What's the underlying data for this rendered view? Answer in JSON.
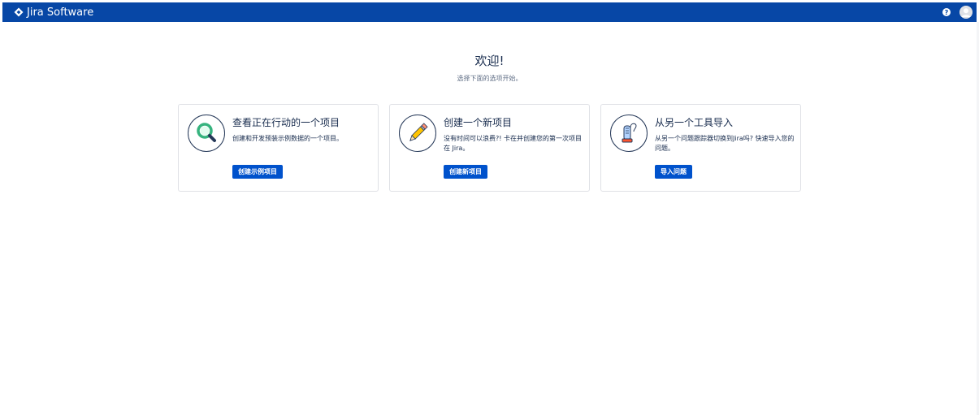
{
  "header": {
    "brand_label": "Jira Software",
    "help_icon_glyph": "?",
    "colors": {
      "bar": "#0747a6",
      "button": "#0052cc"
    }
  },
  "welcome": {
    "title": "欢迎!",
    "subtitle": "选择下面的选项开始。"
  },
  "cards": [
    {
      "icon": "magnifier-icon",
      "title": "查看正在行动的一个项目",
      "description": "创建和开发预装示例数据的一个项目。",
      "button_label": "创建示例项目"
    },
    {
      "icon": "pencil-icon",
      "title": "创建一个新项目",
      "description": "没有时间可以浪费?! 卡在并创建您的第一次项目在 Jira。",
      "button_label": "创建新项目"
    },
    {
      "icon": "vacuum-icon",
      "title": "从另一个工具导入",
      "description": "从另一个问题跟踪器切换到Jira吗? 快速导入您的问题。",
      "button_label": "导入问题"
    }
  ]
}
